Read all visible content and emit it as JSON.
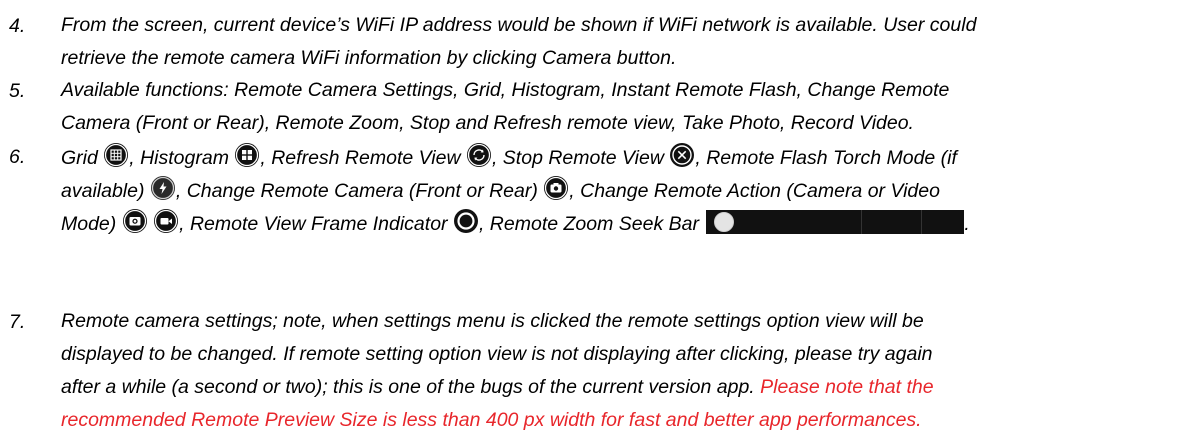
{
  "items": [
    {
      "number": "4.",
      "lines": [
        "From the screen, current device’s WiFi IP address would be shown if WiFi network is available. User could",
        "retrieve the remote camera WiFi information by clicking Camera button."
      ]
    },
    {
      "number": "5.",
      "lines": [
        "Available functions: Remote Camera Settings, Grid, Histogram, Instant Remote Flash, Change Remote",
        "Camera (Front or Rear), Remote Zoom, Stop and Refresh remote view, Take Photo, Record Video."
      ]
    },
    {
      "number": "6.",
      "segments": {
        "grid": "Grid",
        "histogram": ", Histogram",
        "refresh": ", Refresh Remote View",
        "stop": ", Stop Remote View",
        "flash": ", Remote Flash Torch Mode (if",
        "flash_cont": "available)",
        "change_camera": ", Change Remote Camera (Front or Rear)",
        "change_action": ", Change Remote Action (Camera or Video",
        "mode": "Mode)",
        "frame_indicator": ", Remote View Frame Indicator",
        "zoom_seek": ", Remote Zoom Seek Bar",
        "end": "."
      },
      "icons": [
        "grid-icon",
        "histogram-icon",
        "refresh-icon",
        "stop-icon",
        "flash-torch-icon",
        "switch-camera-icon",
        "camera-mode-icon",
        "video-mode-icon",
        "frame-indicator-icon",
        "zoom-seek-bar"
      ]
    },
    {
      "number": "7.",
      "lines": [
        "Remote camera settings; note, when settings menu is clicked the remote settings option view will be",
        "displayed to be changed. If remote setting option view is not displaying after clicking, please try again"
      ],
      "line3_black": "after a while (a second or two); this is one of the bugs of the current version app. ",
      "line3_red": "Please note that the",
      "line4_red": "recommended Remote Preview Size is less than 400 px width for fast and better app performances."
    }
  ],
  "colors": {
    "text": "#000000",
    "highlight": "#e8262b",
    "icon_bg": "#111111"
  }
}
